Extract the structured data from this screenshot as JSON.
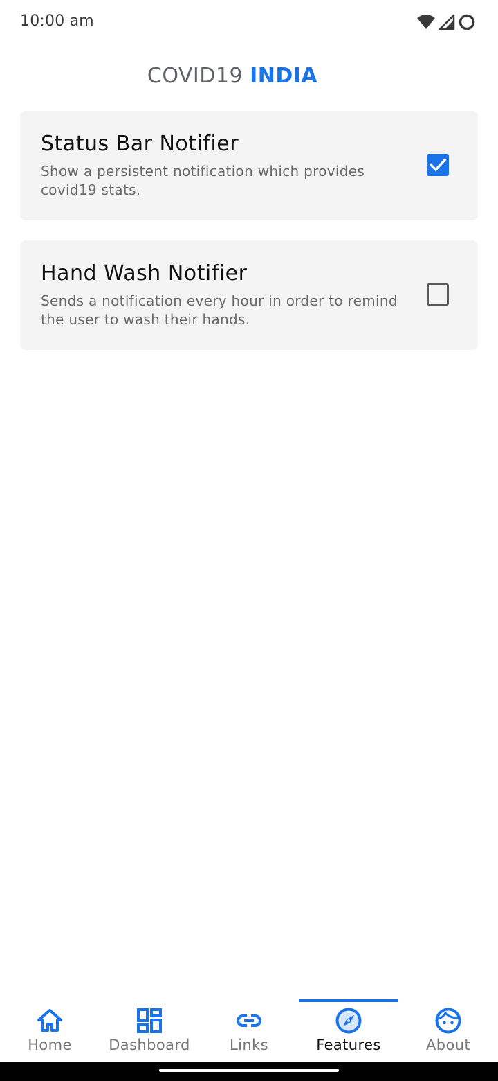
{
  "status_bar": {
    "time": "10:00 am",
    "icons": [
      "wifi-icon",
      "signal-icon",
      "battery-icon"
    ]
  },
  "header": {
    "title_part1": "COVID19",
    "title_part2": "INDIA"
  },
  "features": [
    {
      "title": "Status Bar Notifier",
      "description": "Show a persistent notification which provides covid19 stats.",
      "checked": true
    },
    {
      "title": "Hand Wash Notifier",
      "description": "Sends a notification every hour in order to remind the user to wash their hands.",
      "checked": false
    }
  ],
  "bottom_nav": {
    "active": "Features",
    "items": [
      {
        "label": "Home",
        "icon": "home-icon"
      },
      {
        "label": "Dashboard",
        "icon": "dashboard-icon"
      },
      {
        "label": "Links",
        "icon": "link-icon"
      },
      {
        "label": "Features",
        "icon": "compass-icon"
      },
      {
        "label": "About",
        "icon": "face-icon"
      }
    ]
  },
  "colors": {
    "accent": "#1a73e8",
    "card_background": "#f4f4f4",
    "title_gray": "#5f6368",
    "description_gray": "#6b6b6b"
  }
}
